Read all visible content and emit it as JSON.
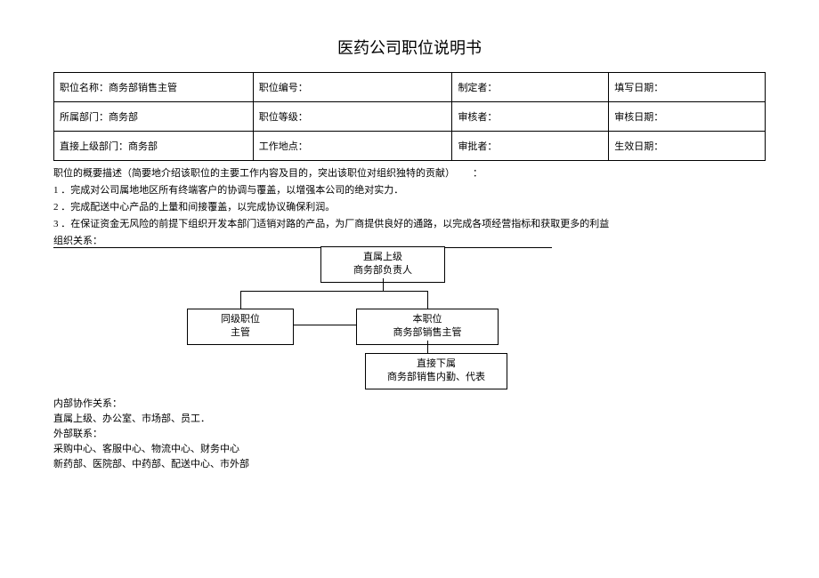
{
  "title": "医药公司职位说明书",
  "table": {
    "r1": {
      "c1": "职位名称：商务部销售主管",
      "c2": "职位编号：",
      "c3": "制定者：",
      "c4": "填写日期："
    },
    "r2": {
      "c1": "所属部门：商务部",
      "c2": "职位等级：",
      "c3": "审核者：",
      "c4": "审核日期："
    },
    "r3": {
      "c1": "直接上级部门：商务部",
      "c2": "工作地点：",
      "c3": "审批者：",
      "c4": "生效日期："
    }
  },
  "desc": {
    "header": "职位的概要描述（简要地介绍该职位的主要工作内容及目的，突出该职位对组织独特的贡献）",
    "colon": "：",
    "l1": "1 ．完成对公司属地地区所有终端客户的协调与覆盖，以增强本公司的绝对实力．",
    "l2": "2 ．完成配送中心产品的上量和间接覆盖，以完成协议确保利润。",
    "l3": "3 ．在保证资金无风险的前提下组织开发本部门适销对路的产品，为厂商提供良好的通路，以完成各项经营指标和获取更多的利益"
  },
  "org_label": "组织关系：",
  "org": {
    "top": {
      "l1": "直属上级",
      "l2": "商务部负责人"
    },
    "peer": {
      "l1": "同级职位",
      "l2": "主管"
    },
    "self": {
      "l1": "本职位",
      "l2": "商务部销售主管"
    },
    "sub": {
      "l1": "直接下属",
      "l2": "商务部销售内勤、代表"
    }
  },
  "internal": {
    "h1": "内部协作关系：",
    "l1": "直属上级、办公室、市场部、员工．",
    "h2": "外部联系：",
    "l2": "采购中心、客服中心、物流中心、财务中心",
    "l3": "新药部、医院部、中药部、配送中心、市外部"
  }
}
